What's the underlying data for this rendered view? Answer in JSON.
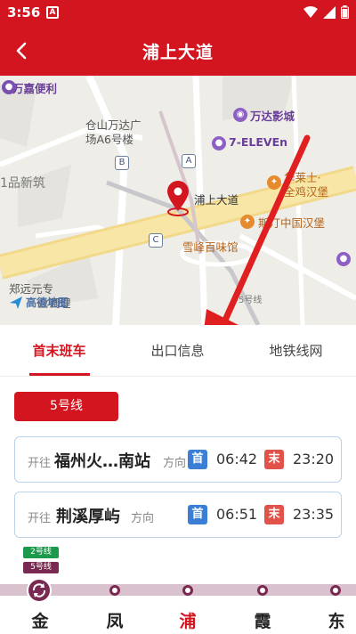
{
  "status_bar": {
    "time": "3:56",
    "notif_letter": "A"
  },
  "header": {
    "title": "浦上大道"
  },
  "map": {
    "labels": {
      "wanjia": "万嘉便利",
      "cangshan": "仓山万达广",
      "cangshan2": "场A6号楼",
      "wanda_cinema": "万达影城",
      "seven": "7-ELEVEn",
      "yipin": "1品新筑",
      "station": "浦上大道",
      "hualaishi": "华莱士·",
      "hualaishi2": "全鸡汉堡",
      "dekes": "斯汀中国汉堡",
      "xuefeng": "雪峰百味馆",
      "zhengyuan": "郑远元专",
      "zhengyuan2": "业调理",
      "line5": "5号线",
      "gaode": "高德地图"
    },
    "exits": {
      "a": "A",
      "b": "B",
      "c": "C"
    }
  },
  "tabs": [
    {
      "label": "首末班车"
    },
    {
      "label": "出口信息"
    },
    {
      "label": "地铁线网"
    }
  ],
  "line_badge": "5号线",
  "directions": [
    {
      "prefix": "开往",
      "station": "福州火…南站",
      "suffix": "方向",
      "first_tag": "首",
      "first_time": "06:42",
      "last_tag": "末",
      "last_time": "23:20"
    },
    {
      "prefix": "开往",
      "station": "荆溪厚屿",
      "suffix": "方向",
      "first_tag": "首",
      "first_time": "06:51",
      "last_tag": "末",
      "last_time": "23:35"
    }
  ],
  "line_strip": {
    "transfer_lines": [
      "2号线",
      "5号线"
    ],
    "stations": [
      "金",
      "凤",
      "浦",
      "霞",
      "东"
    ]
  },
  "colors": {
    "brand": "#d3151f",
    "line5": "#7a2a52",
    "line2": "#1a9a4a"
  }
}
